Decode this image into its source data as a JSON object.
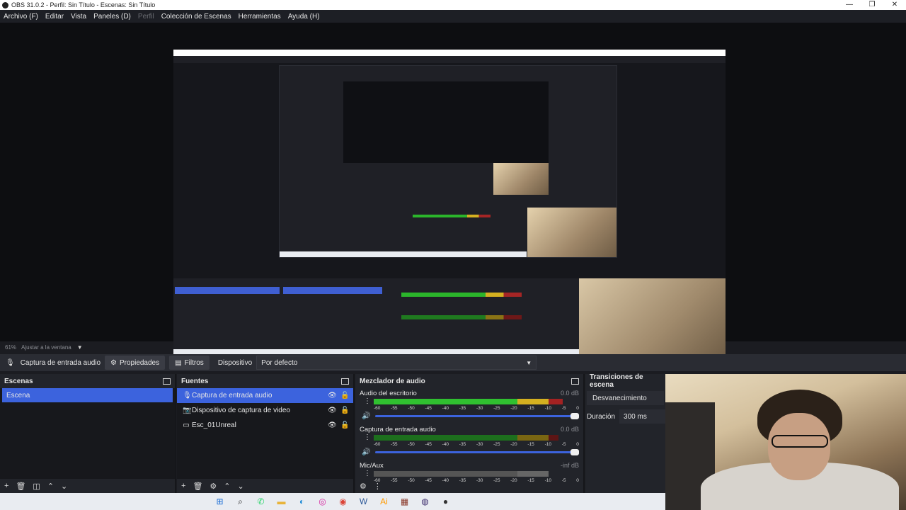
{
  "window": {
    "title": "OBS 31.0.2 - Perfil: Sin Título - Escenas: Sin Título",
    "controls": [
      "—",
      "❐",
      "✕"
    ]
  },
  "menu": [
    {
      "label": "Archivo (F)",
      "disabled": false
    },
    {
      "label": "Editar",
      "disabled": false
    },
    {
      "label": "Vista",
      "disabled": false
    },
    {
      "label": "Paneles (D)",
      "disabled": false
    },
    {
      "label": "Perfil",
      "disabled": true
    },
    {
      "label": "Colección de Escenas",
      "disabled": false
    },
    {
      "label": "Herramientas",
      "disabled": false
    },
    {
      "label": "Ayuda (H)",
      "disabled": false
    }
  ],
  "zoom": {
    "percent": "61%",
    "fit_label": "Ajustar a la ventana"
  },
  "context": {
    "source_name": "Captura de entrada audio",
    "properties_label": "Propiedades",
    "filters_label": "Filtros",
    "device_label": "Dispositivo",
    "device_value": "Por defecto"
  },
  "scenes": {
    "title": "Escenas",
    "items": [
      "Escena"
    ],
    "footer_icons": [
      "+",
      "🗑",
      "◫",
      "⌃",
      "⌄"
    ]
  },
  "sources": {
    "title": "Fuentes",
    "items": [
      {
        "name": "Captura de entrada audio",
        "icon": "mic-icon",
        "glyph": "🎙"
      },
      {
        "name": "Dispositivo de captura de video",
        "icon": "camera-icon",
        "glyph": "📷"
      },
      {
        "name": "Esc_01Unreal",
        "icon": "monitor-icon",
        "glyph": "▭"
      }
    ],
    "footer_icons": [
      "+",
      "🗑",
      "⚙",
      "⌃",
      "⌄"
    ]
  },
  "mixer": {
    "title": "Mezclador de audio",
    "ticks": [
      "-60",
      "-55",
      "-50",
      "-45",
      "-40",
      "-35",
      "-30",
      "-25",
      "-20",
      "-15",
      "-10",
      "-5",
      "0"
    ],
    "channels": [
      {
        "name": "Audio del escritorio",
        "db": "0.0 dB",
        "level": 0.92,
        "style": "bright"
      },
      {
        "name": "Captura de entrada audio",
        "db": "0.0 dB",
        "level": 0.9,
        "style": "dim"
      },
      {
        "name": "Mic/Aux",
        "db": "-inf dB",
        "level": 0.85,
        "style": "gray"
      }
    ]
  },
  "transitions": {
    "title": "Transiciones de escena",
    "selected": "Desvanecimiento",
    "duration_label": "Duración",
    "duration_value": "300 ms"
  },
  "taskbar": {
    "icons": [
      {
        "name": "windows-start-icon",
        "glyph": "⊞",
        "color": "#1f6fd6"
      },
      {
        "name": "search-icon",
        "glyph": "⌕",
        "color": "#222222"
      },
      {
        "name": "whatsapp-icon",
        "glyph": "✆",
        "color": "#25d366"
      },
      {
        "name": "folder-icon",
        "glyph": "▬",
        "color": "#e8b339"
      },
      {
        "name": "edge-icon",
        "glyph": "◐",
        "color": "#1f8ad6"
      },
      {
        "name": "instagram-icon",
        "glyph": "◎",
        "color": "#d6249f"
      },
      {
        "name": "chrome-icon",
        "glyph": "◉",
        "color": "#db4437"
      },
      {
        "name": "word-icon",
        "glyph": "W",
        "color": "#2b5797"
      },
      {
        "name": "illustrator-icon",
        "glyph": "Ai",
        "color": "#ff9a00"
      },
      {
        "name": "media-icon",
        "glyph": "▦",
        "color": "#8b3a2b"
      },
      {
        "name": "obs-icon",
        "glyph": "◍",
        "color": "#3a2a6b"
      },
      {
        "name": "app-icon",
        "glyph": "●",
        "color": "#333333"
      }
    ]
  }
}
